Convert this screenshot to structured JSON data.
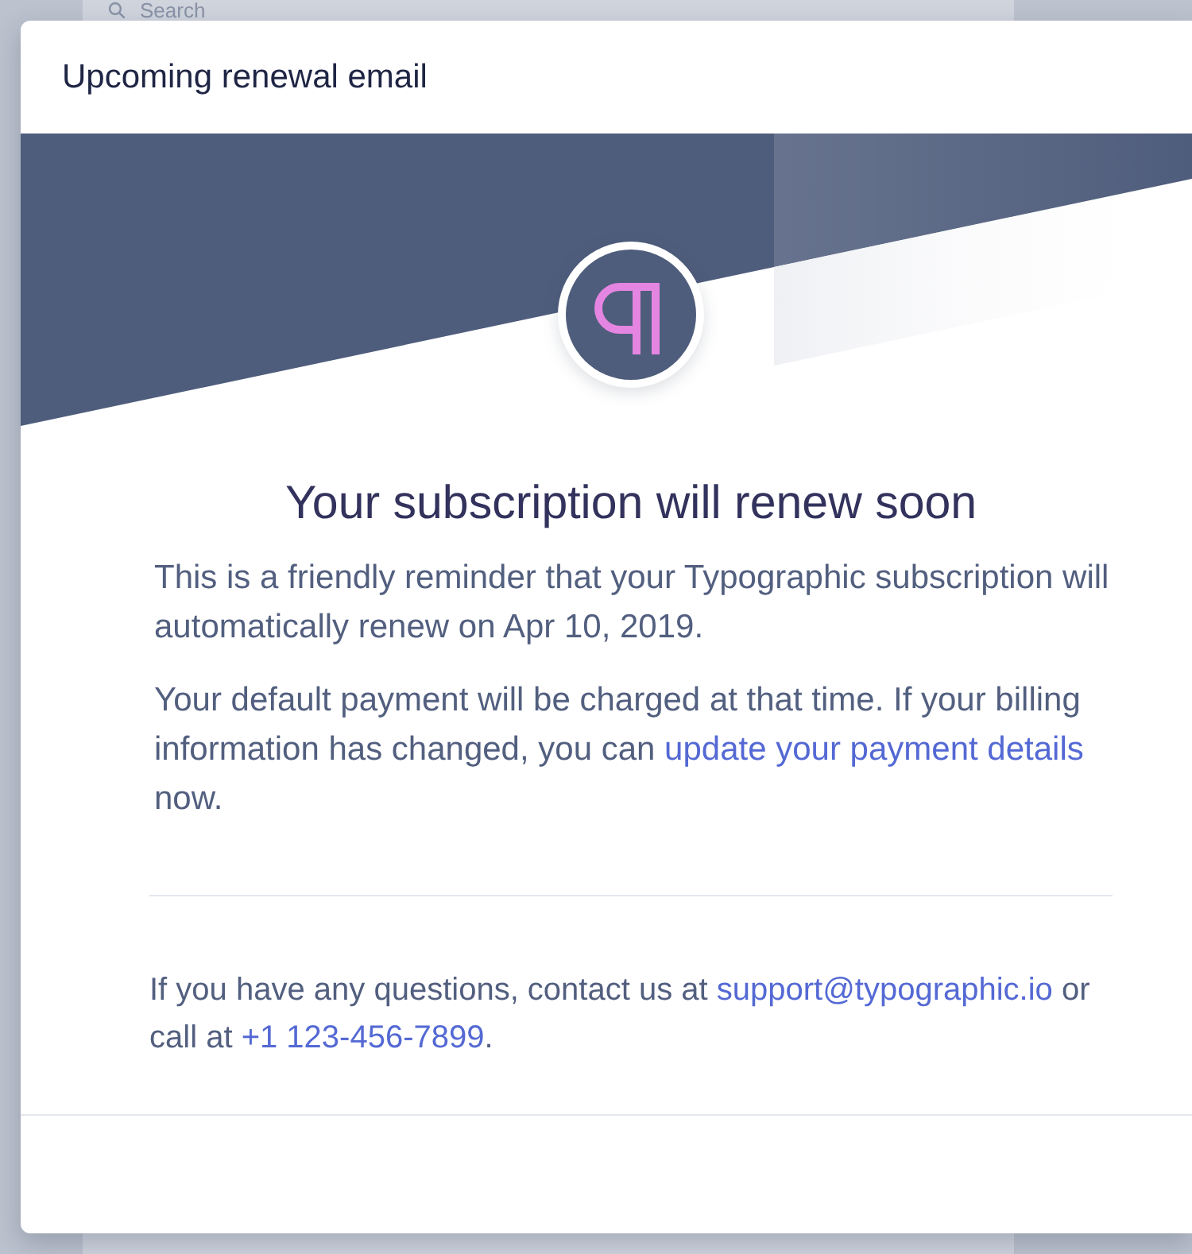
{
  "background": {
    "search": {
      "placeholder": "Search"
    }
  },
  "modal": {
    "title": "Upcoming renewal email",
    "email": {
      "heading": "Your subscription will renew soon",
      "paragraphs": [
        {
          "parts": [
            {
              "kind": "text",
              "text": "This is a friendly reminder that your Typographic subscription will automatically renew on Apr 10, 2019."
            }
          ]
        },
        {
          "parts": [
            {
              "kind": "text",
              "text": "Your default payment will be charged at that time. If your billing information has changed, you can "
            },
            {
              "kind": "link",
              "text": "update your payment details"
            },
            {
              "kind": "text",
              "text": " now."
            }
          ]
        }
      ],
      "contact": {
        "parts": [
          {
            "kind": "text",
            "text": "If you have any questions, contact us at "
          },
          {
            "kind": "link",
            "text": "support@typographic.io"
          },
          {
            "kind": "text",
            "text": " or call at "
          },
          {
            "kind": "link",
            "text": "+1 123-456-7899"
          },
          {
            "kind": "text",
            "text": "."
          }
        ]
      }
    }
  }
}
